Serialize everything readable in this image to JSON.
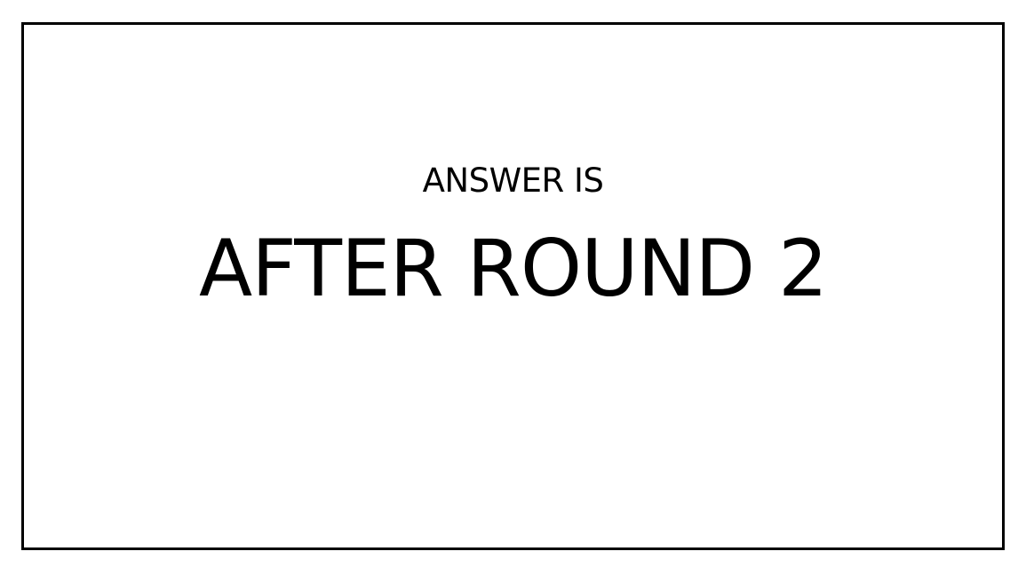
{
  "slide": {
    "subtitle": "ANSWER IS",
    "headline": "AFTER ROUND 2"
  },
  "colors": {
    "background": "#ffffff",
    "text": "#000000",
    "border": "#000000"
  }
}
